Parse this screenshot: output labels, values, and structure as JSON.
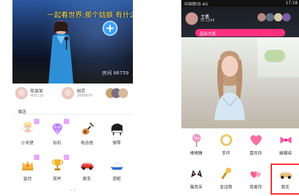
{
  "left": {
    "subtitle": "一起看世界:那个姑娘 有什么事",
    "room_id": "房间 86759",
    "users": [
      {
        "name": "陈某某",
        "id": "400110"
      },
      {
        "name": "胡灵",
        "id": "2888876"
      }
    ],
    "gift_section_title": "赠送",
    "gifts": [
      {
        "label": "小天使",
        "icon": "angel-icon"
      },
      {
        "label": "钻石",
        "icon": "diamond-icon"
      },
      {
        "label": "电吉他",
        "icon": "guitar-icon"
      },
      {
        "label": "钢琴",
        "icon": "piano-icon"
      },
      {
        "label": "皇冠",
        "icon": "crown-icon"
      },
      {
        "label": "奖杯",
        "icon": "trophy-icon"
      },
      {
        "label": "跑车",
        "icon": "car-icon"
      },
      {
        "label": "游艇",
        "icon": "yacht-icon"
      }
    ],
    "page_indicator": "• •"
  },
  "right": {
    "status_left": "中国移动 4G",
    "status_right": "17:18",
    "anchor_name": "主播",
    "anchor_sub": "ID 1234",
    "banner_text": "送出大奖",
    "gifts": [
      {
        "label": "棒棒糖",
        "icon": "lollipop-icon"
      },
      {
        "label": "手环",
        "icon": "bracelet-icon"
      },
      {
        "label": "喜欢你",
        "icon": "heart-icon"
      },
      {
        "label": "蝴蝶结",
        "icon": "bow-icon"
      },
      {
        "label": "猫耳朵",
        "icon": "cat-ears-icon"
      },
      {
        "label": "金话筒",
        "icon": "microphone-icon"
      },
      {
        "label": "我爱你",
        "icon": "love-icon"
      },
      {
        "label": "跑车",
        "icon": "car-icon"
      }
    ]
  },
  "colors": {
    "accent_pink": "#ff2f7e",
    "selection_red": "#ff2b2b",
    "badge_purple": "#e8a9ff"
  }
}
